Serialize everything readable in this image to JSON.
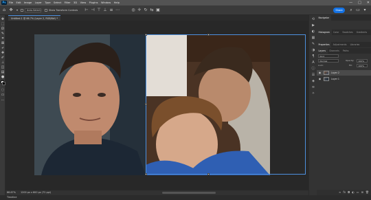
{
  "app": {
    "logo": "Ps"
  },
  "menu": [
    "File",
    "Edit",
    "Image",
    "Layer",
    "Type",
    "Select",
    "Filter",
    "3D",
    "View",
    "Plugins",
    "Window",
    "Help"
  ],
  "window_controls": {
    "minimize": "—",
    "maximize": "□",
    "close": "✕"
  },
  "options_bar": {
    "auto_select_label": "Auto-Select:",
    "show_transform_label": "Show Transform Controls",
    "share_label": "Share"
  },
  "document": {
    "tab_title": "Untitled-1 @ 66.7% (Layer 2, RGB/8#) *",
    "zoom": "66.67%",
    "size": "1200 px x 600 px (72 ppi)"
  },
  "panels": {
    "top_tabs": [
      "Navigator"
    ],
    "mid_tabs": [
      "Histogram",
      "Color",
      "Swatches",
      "Gradients"
    ],
    "prop_tabs": [
      "Properties",
      "Adjustments",
      "Libraries"
    ],
    "layer_tabs": [
      "Layers",
      "Channels",
      "Paths"
    ],
    "kind_label": "Kind",
    "blend_mode": "Normal",
    "opacity_label": "Opacity:",
    "opacity_value": "100%",
    "lock_label": "Lock:",
    "fill_label": "Fill:",
    "fill_value": "100%",
    "layers": [
      {
        "name": "Layer 2",
        "visible": true,
        "selected": true
      },
      {
        "name": "Layer 1",
        "visible": true,
        "selected": false
      }
    ]
  },
  "status": {
    "timeline_tab": "Timeline"
  },
  "colors": {
    "accent": "#1473e6",
    "selection": "#4e91e0",
    "panel_bg": "#333333",
    "canvas_bg": "#282828"
  }
}
